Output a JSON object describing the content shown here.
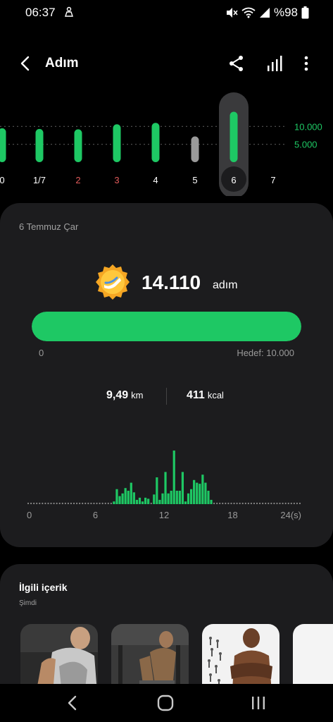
{
  "status": {
    "time": "06:37",
    "battery": "%98"
  },
  "app_bar": {
    "title": "Adım",
    "back_icon": "back-arrow-icon",
    "share_icon": "share-icon",
    "stats_icon": "bar-chart-icon",
    "more_icon": "more-vertical-icon"
  },
  "weekly": {
    "day_labels": [
      "0",
      "1/7",
      "2",
      "3",
      "4",
      "5",
      "6",
      "7"
    ],
    "day_label_colors": [
      "#ffffff",
      "#ffffff",
      "#e05a5a",
      "#e05a5a",
      "#ffffff",
      "#ffffff",
      "#ffffff",
      "#ffffff"
    ],
    "selected_day": "6",
    "gridline_labels": [
      "10.000",
      "5.000"
    ],
    "colors": {
      "goal_met": "#1ec864",
      "goal_missed": "#9a9a9a",
      "grid_label": "#1ec864"
    }
  },
  "summary": {
    "date": "6 Temmuz Çar",
    "steps": "14.110",
    "steps_unit": "adım",
    "progress_min": "0",
    "goal_label": "Hedef: 10.000",
    "progress_fraction": 1.0,
    "distance_value": "9,49",
    "distance_unit": "km",
    "calories_value": "411",
    "calories_unit": "kcal"
  },
  "chart_data": [
    {
      "type": "bar",
      "categories": [
        "0",
        "1/7",
        "2",
        "3",
        "4",
        "5",
        "6"
      ],
      "values": [
        9500,
        9300,
        9200,
        10600,
        11000,
        7200,
        14110
      ],
      "gridlines": [
        10000,
        5000
      ],
      "gridline_labels": [
        "10.000",
        "5.000"
      ],
      "ylim": [
        0,
        15000
      ]
    },
    {
      "type": "bar",
      "x_tick_labels": [
        "0",
        "6",
        "12",
        "18",
        "24(s)"
      ],
      "xlim": [
        0,
        24
      ],
      "bin_hours": 0.5,
      "values": [
        0,
        0,
        0,
        0,
        0,
        0,
        0,
        0,
        0,
        0,
        0,
        0,
        0,
        0,
        0,
        0,
        0,
        0,
        0,
        0,
        0,
        0,
        0,
        0,
        0,
        0,
        0,
        0,
        0,
        0,
        5,
        28,
        15,
        20,
        30,
        25,
        40,
        22,
        8,
        12,
        5,
        12,
        10,
        0,
        18,
        50,
        8,
        20,
        60,
        20,
        25,
        100,
        25,
        25,
        60,
        5,
        20,
        28,
        45,
        40,
        38,
        55,
        40,
        25,
        8,
        0,
        0,
        0,
        0,
        0,
        0,
        0,
        0,
        0,
        0,
        0,
        0,
        0,
        0,
        0,
        0,
        0,
        0,
        0,
        0,
        0,
        0,
        0,
        0,
        0,
        0,
        0,
        0,
        0,
        0,
        0
      ],
      "ylim": [
        0,
        100
      ]
    }
  ],
  "related": {
    "title": "İlgili içerik",
    "subtitle": "Şimdi"
  },
  "nav": {
    "back_icon": "nav-back-icon",
    "home_icon": "nav-home-icon",
    "recent_icon": "nav-recent-icon"
  }
}
